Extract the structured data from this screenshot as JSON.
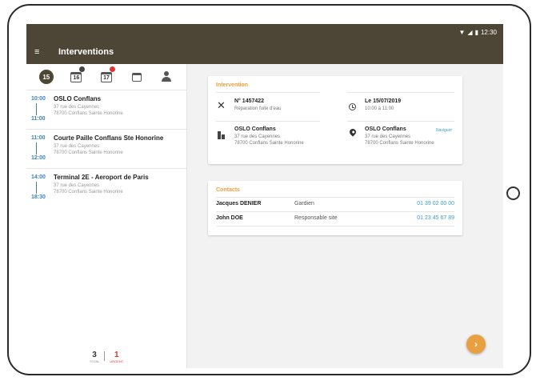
{
  "status_bar": {
    "time": "12:30"
  },
  "app_bar": {
    "title": "Interventions"
  },
  "dates": [
    {
      "label": "15",
      "active": true
    },
    {
      "label": "16",
      "badge": "dark"
    },
    {
      "label": "17",
      "badge": "red"
    }
  ],
  "interventions": [
    {
      "start": "10:00",
      "end": "11:00",
      "title": "OSLO Conflans",
      "addr1": "37 rue des Cayennes",
      "addr2": "78700 Conflans Sainte Honorine"
    },
    {
      "start": "11:00",
      "end": "12:00",
      "title": "Courte Paille Conflans Ste Honorine",
      "addr1": "37 rue des Cayennes",
      "addr2": "78700 Conflans Sainte Honorine"
    },
    {
      "start": "14:00",
      "end": "18:30",
      "title": "Terminal 2E - Aeroport de Paris",
      "addr1": "37 rue des Cayennes",
      "addr2": "78700 Conflans Sainte Honorine"
    }
  ],
  "counts": {
    "left_value": "3",
    "left_label": "total",
    "right_value": "1",
    "right_label": "urgent"
  },
  "intervention_card": {
    "title": "Intervention",
    "number": "N° 1457422",
    "description": "Réparation fuite d'eau",
    "date": "Le 15/07/2019",
    "time_range": "10:00 à 11:00",
    "client_name": "OSLO Conflans",
    "client_addr1": "37 rue des Cayennes",
    "client_addr2": "78700 Conflans Sainte Honorine",
    "site_name": "OSLO Conflans",
    "site_addr1": "37 rue des Cayennes",
    "site_addr2": "78700 Conflans Sainte Honorine",
    "site_link": "Naviguer"
  },
  "contacts_card": {
    "title": "Contacts",
    "rows": [
      {
        "name": "Jacques DENIER",
        "role": "Gardien",
        "phone": "01 39 02 00 00"
      },
      {
        "name": "John DOE",
        "role": "Responsable site",
        "phone": "01 23 45 67 89"
      }
    ]
  },
  "fab": {
    "icon": "chevron-right-icon",
    "glyph": "›"
  },
  "colors": {
    "appbar": "#4d4536",
    "accent": "#e8a040",
    "link": "#3a9ad9",
    "urgent": "#e0342e"
  }
}
